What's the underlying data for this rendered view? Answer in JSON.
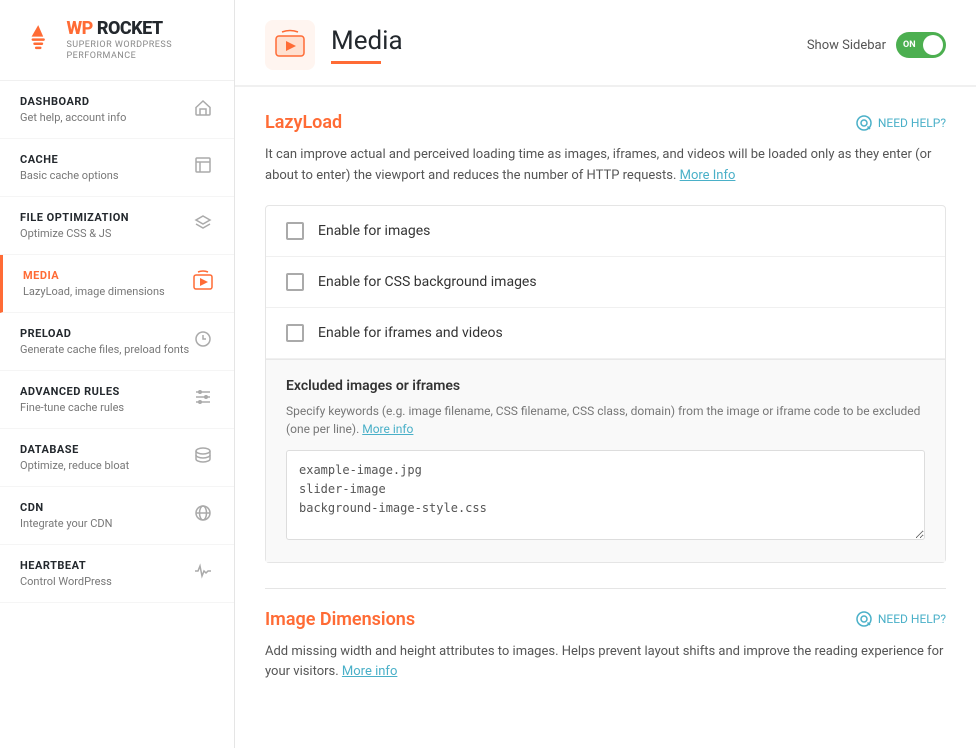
{
  "logo": {
    "wp_text": "WP",
    "rocket_text": "ROCKET",
    "tagline": "Superior WordPress Performance"
  },
  "sidebar": {
    "items": [
      {
        "id": "dashboard",
        "title": "DASHBOARD",
        "subtitle": "Get help, account info",
        "icon": "🏠"
      },
      {
        "id": "cache",
        "title": "CACHE",
        "subtitle": "Basic cache options",
        "icon": "📄"
      },
      {
        "id": "file-optimization",
        "title": "FILE OPTIMIZATION",
        "subtitle": "Optimize CSS & JS",
        "icon": "⬡"
      },
      {
        "id": "media",
        "title": "MEDIA",
        "subtitle": "LazyLoad, image dimensions",
        "icon": "🖼",
        "active": true
      },
      {
        "id": "preload",
        "title": "PRELOAD",
        "subtitle": "Generate cache files, preload fonts",
        "icon": "↻"
      },
      {
        "id": "advanced-rules",
        "title": "ADVANCED RULES",
        "subtitle": "Fine-tune cache rules",
        "icon": "≡"
      },
      {
        "id": "database",
        "title": "DATABASE",
        "subtitle": "Optimize, reduce bloat",
        "icon": "🗄"
      },
      {
        "id": "cdn",
        "title": "CDN",
        "subtitle": "Integrate your CDN",
        "icon": "🌐"
      },
      {
        "id": "heartbeat",
        "title": "HEARTBEAT",
        "subtitle": "Control WordPress",
        "icon": "♥"
      }
    ]
  },
  "header": {
    "page_icon": "🖼",
    "page_title": "Media",
    "show_sidebar_label": "Show Sidebar",
    "toggle_label": "ON"
  },
  "lazyload": {
    "section_title": "LazyLoad",
    "need_help_label": "NEED HELP?",
    "description": "It can improve actual and perceived loading time as images, iframes, and videos will be loaded only as they enter (or about to enter) the viewport and reduces the number of HTTP requests.",
    "more_info_link": "More Info",
    "options": [
      {
        "id": "enable-images",
        "label": "Enable for images"
      },
      {
        "id": "enable-css-bg",
        "label": "Enable for CSS background images"
      },
      {
        "id": "enable-iframes",
        "label": "Enable for iframes and videos"
      }
    ],
    "excluded": {
      "title": "Excluded images or iframes",
      "description": "Specify keywords (e.g. image filename, CSS filename, CSS class, domain) from the image or iframe code to be excluded (one per line).",
      "more_info_link": "More info",
      "placeholder_lines": "example-image.jpg\nslider-image\nbackground-image-style.css"
    }
  },
  "image_dimensions": {
    "section_title": "Image Dimensions",
    "need_help_label": "NEED HELP?",
    "description": "Add missing width and height attributes to images. Helps prevent layout shifts and improve the reading experience for your visitors.",
    "more_info_link": "More info"
  }
}
